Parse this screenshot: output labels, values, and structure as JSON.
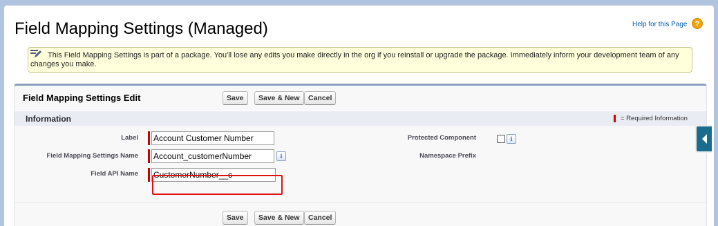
{
  "header": {
    "title": "Field Mapping Settings (Managed)",
    "help_link": "Help for this Page",
    "help_icon": "help-circle-icon"
  },
  "warning": {
    "icon": "edit-pencil-icon",
    "text": "This Field Mapping Settings is part of a package. You'll lose any edits you make directly in the org if you reinstall or upgrade the package. Immediately inform your development team of any changes you make."
  },
  "edit_block": {
    "title": "Field Mapping Settings Edit",
    "buttons": {
      "save": "Save",
      "save_new": "Save & New",
      "cancel": "Cancel"
    }
  },
  "section": {
    "title": "Information",
    "required_legend": "= Required Information"
  },
  "fields": {
    "label": {
      "label": "Label",
      "value": "Account Customer Number"
    },
    "name": {
      "label": "Field Mapping Settings Name",
      "value": "Account_customerNumber"
    },
    "api_name": {
      "label": "Field API Name",
      "value": "CustomerNumber__c"
    },
    "protected": {
      "label": "Protected Component",
      "checked": false
    },
    "namespace": {
      "label": "Namespace Prefix",
      "value": ""
    }
  },
  "colors": {
    "accent": "#1a6c8c",
    "required": "#cc0000",
    "highlight": "#e01010",
    "link": "#015ba7"
  }
}
